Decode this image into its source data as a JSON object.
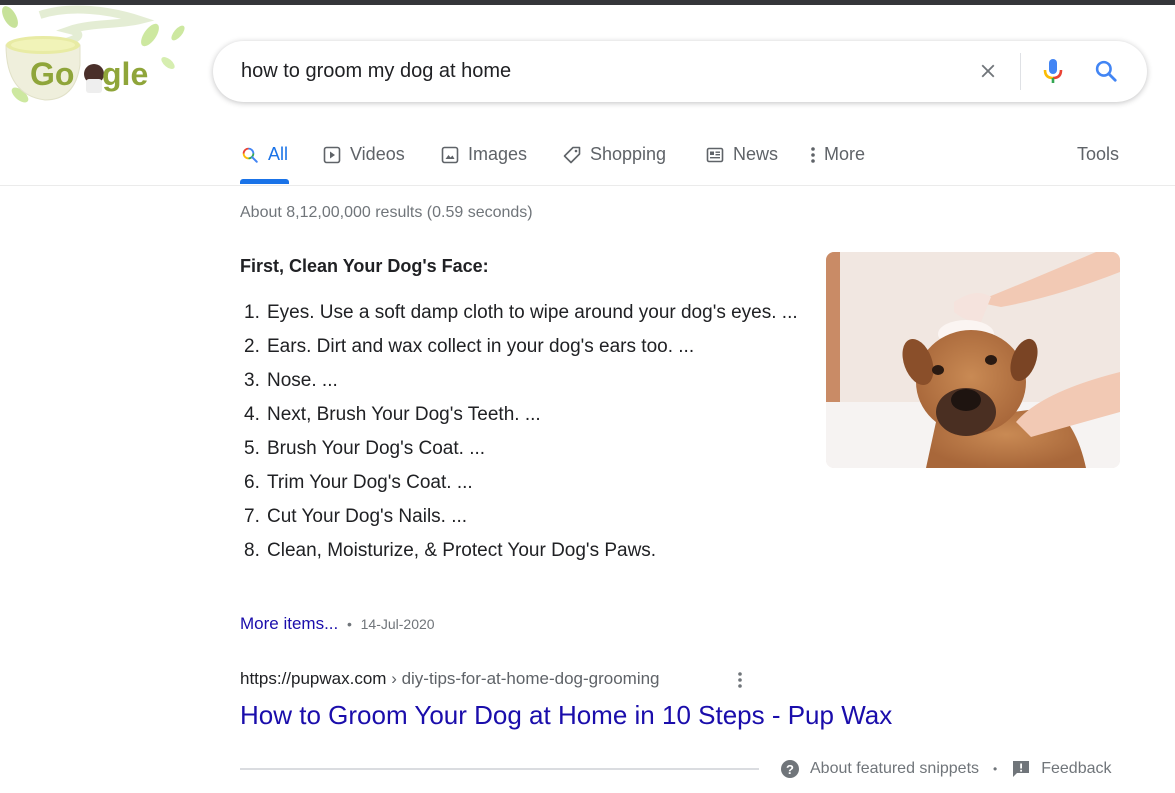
{
  "logo": {
    "alt": "Google",
    "letters": [
      "G",
      "o",
      "g",
      "l",
      "e"
    ]
  },
  "search": {
    "query": "how to groom my dog at home",
    "clear_icon": "close-icon",
    "mic_icon": "microphone-icon",
    "search_icon": "search-icon"
  },
  "tabs": [
    {
      "label": "All",
      "icon": "search-icon",
      "active": true
    },
    {
      "label": "Videos",
      "icon": "play-icon",
      "active": false
    },
    {
      "label": "Images",
      "icon": "image-icon",
      "active": false
    },
    {
      "label": "Shopping",
      "icon": "tag-icon",
      "active": false
    },
    {
      "label": "News",
      "icon": "newspaper-icon",
      "active": false
    },
    {
      "label": "More",
      "icon": "more-vertical-icon",
      "active": false
    }
  ],
  "tools_label": "Tools",
  "stats": "About 8,12,00,000 results (0.59 seconds)",
  "snippet": {
    "heading": "First, Clean Your Dog's Face:",
    "items": [
      {
        "num": "1.",
        "text": "Eyes. Use a soft damp cloth to wipe around your dog's eyes. ..."
      },
      {
        "num": "2.",
        "text": "Ears. Dirt and wax collect in your dog's ears too. ..."
      },
      {
        "num": "3.",
        "text": "Nose. ..."
      },
      {
        "num": "4.",
        "text": "Next, Brush Your Dog's Teeth. ..."
      },
      {
        "num": "5.",
        "text": "Brush Your Dog's Coat. ..."
      },
      {
        "num": "6.",
        "text": "Trim Your Dog's Coat. ..."
      },
      {
        "num": "7.",
        "text": "Cut Your Dog's Nails. ..."
      },
      {
        "num": "8.",
        "text": "Clean, Moisturize, & Protect Your Dog's Paws."
      }
    ],
    "more_items": "More items...",
    "separator": "•",
    "date": "14-Jul-2020",
    "image_alt": "Dog being shampooed in a bathtub"
  },
  "result": {
    "cite_domain": "https://pupwax.com",
    "cite_path": " › diy-tips-for-at-home-dog-grooming",
    "title": "How to Groom Your Dog at Home in 10 Steps - Pup Wax"
  },
  "footer": {
    "about": "About featured snippets",
    "separator": "•",
    "feedback": "Feedback"
  },
  "colors": {
    "link": "#1a0dab",
    "accent": "#1a73e8",
    "muted": "#70757a",
    "text": "#202124"
  }
}
